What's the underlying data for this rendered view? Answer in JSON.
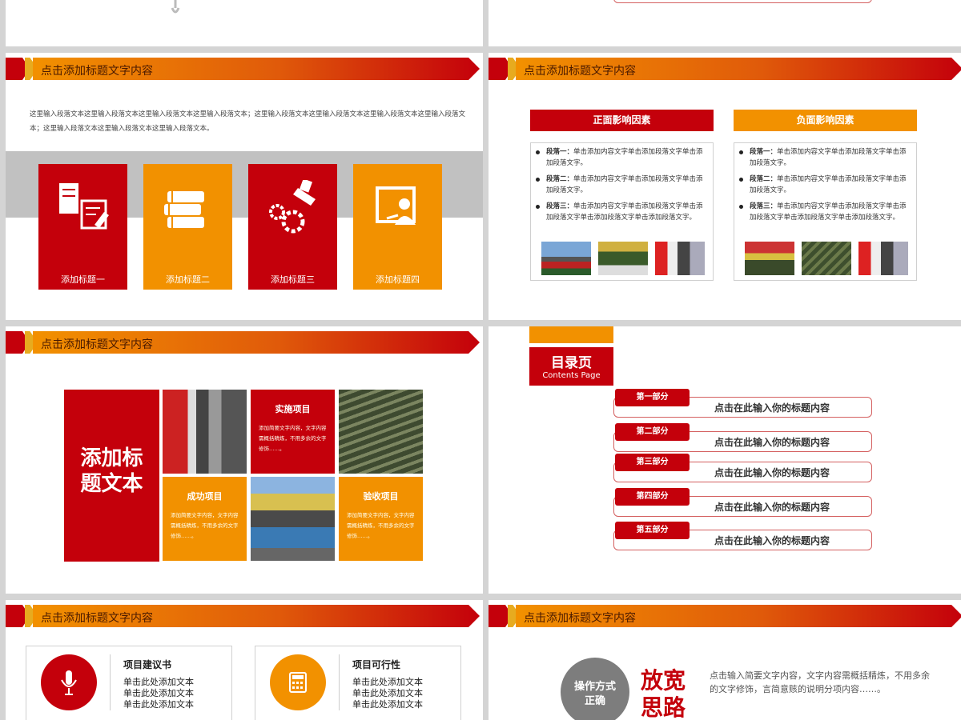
{
  "colors": {
    "red": "#c4000b",
    "orange": "#f29100",
    "gray": "#7d7d7d"
  },
  "banner_title": "点击添加标题文字内容",
  "slide_a": {
    "paragraph": "这里输入段落文本这里输入段落文本这里输入段落文本这里输入段落文本；这里输入段落文本这里输入段落文本这里输入段落文本这里输入段落文本；这里输入段落文本这里输入段落文本这里输入段落文本。",
    "cards": [
      {
        "label": "添加标题一",
        "icon": "document-edit-icon"
      },
      {
        "label": "添加标题二",
        "icon": "books-icon"
      },
      {
        "label": "添加标题三",
        "icon": "gears-tools-icon"
      },
      {
        "label": "添加标题四",
        "icon": "presenter-board-icon"
      }
    ]
  },
  "slide_b": {
    "positive": {
      "header": "正面影响因素",
      "items": [
        {
          "label": "段落一：",
          "text": "单击添加内容文字单击添加段落文字单击添加段落文字。"
        },
        {
          "label": "段落二：",
          "text": "单击添加内容文字单击添加段落文字单击添加段落文字。"
        },
        {
          "label": "段落三：",
          "text": "单击添加内容文字单击添加段落文字单击添加段落文字单击添加段落文字单击添加段落文字。"
        }
      ]
    },
    "negative": {
      "header": "负面影响因素",
      "items": [
        {
          "label": "段落一：",
          "text": "单击添加内容文字单击添加段落文字单击添加段落文字。"
        },
        {
          "label": "段落二：",
          "text": "单击添加内容文字单击添加段落文字单击添加段落文字。"
        },
        {
          "label": "段落三：",
          "text": "单击添加内容文字单击添加段落文字单击添加段落文字单击添加段落文字单击添加段落文字。"
        }
      ]
    }
  },
  "slide_c": {
    "big_title": "添加标题文本",
    "cells": [
      {
        "title": "实施项目",
        "desc": "添加简要文字内容，文字内容需概括精炼，不用多余的文字修饰……。"
      },
      {
        "title": "成功项目",
        "desc": "添加简要文字内容，文字内容需概括精炼，不用多余的文字修饰……。"
      },
      {
        "title": "验收项目",
        "desc": "添加简要文字内容，文字内容需概括精炼，不用多余的文字修饰……。"
      }
    ]
  },
  "slide_d": {
    "title": "目录页",
    "subtitle": "Contents Page",
    "items": [
      {
        "tag": "第一部分",
        "text": "点击在此输入你的标题内容"
      },
      {
        "tag": "第二部分",
        "text": "点击在此输入你的标题内容"
      },
      {
        "tag": "第三部分",
        "text": "点击在此输入你的标题内容"
      },
      {
        "tag": "第四部分",
        "text": "点击在此输入你的标题内容"
      },
      {
        "tag": "第五部分",
        "text": "点击在此输入你的标题内容"
      }
    ]
  },
  "slide_e": {
    "boxes": [
      {
        "title": "项目建议书",
        "lines": [
          "单击此处添加文本",
          "单击此处添加文本",
          "单击此处添加文本"
        ],
        "icon": "microphone-icon"
      },
      {
        "title": "项目可行性",
        "lines": [
          "单击此处添加文本",
          "单击此处添加文本",
          "单击此处添加文本"
        ],
        "icon": "calculator-icon"
      }
    ]
  },
  "slide_f": {
    "circle_text_1": "操作方式",
    "circle_text_2": "正确",
    "big_1": "放宽",
    "big_2": "思路",
    "desc": "点击输入简要文字内容，文字内容需概括精炼，不用多余的文字修饰，言简意赅的说明分项内容……。"
  }
}
